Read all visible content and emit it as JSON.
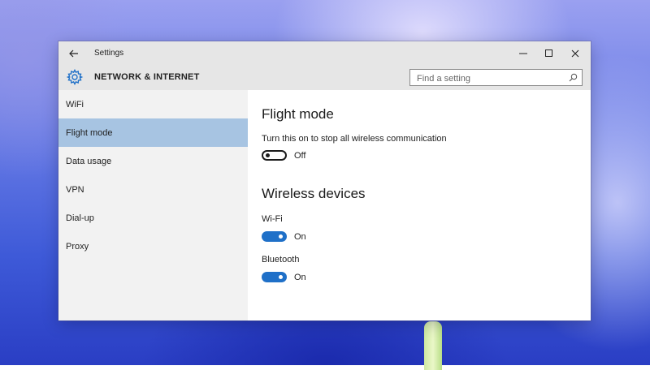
{
  "window": {
    "title": "Settings",
    "controls": [
      "minimize",
      "maximize",
      "close"
    ]
  },
  "header": {
    "section_title": "NETWORK & INTERNET",
    "search_placeholder": "Find a setting",
    "search_value": ""
  },
  "sidebar": {
    "items": [
      {
        "label": "WiFi",
        "selected": false
      },
      {
        "label": "Flight mode",
        "selected": true
      },
      {
        "label": "Data usage",
        "selected": false
      },
      {
        "label": "VPN",
        "selected": false
      },
      {
        "label": "Dial-up",
        "selected": false
      },
      {
        "label": "Proxy",
        "selected": false
      }
    ]
  },
  "flight_mode": {
    "heading": "Flight mode",
    "description": "Turn this on to stop all wireless communication",
    "state_label": "Off",
    "enabled": false
  },
  "wireless_devices": {
    "heading": "Wireless devices",
    "devices": [
      {
        "name": "Wi-Fi",
        "state_label": "On",
        "enabled": true
      },
      {
        "name": "Bluetooth",
        "state_label": "On",
        "enabled": true
      }
    ]
  },
  "colors": {
    "accent": "#1f70c8",
    "selected_nav": "#a7c4e2",
    "chrome": "#e6e6e6",
    "sidebar": "#f2f2f2"
  },
  "icons": {
    "back": "back-arrow-icon",
    "settings": "gear-icon",
    "search": "search-icon",
    "minimize": "minimize-icon",
    "maximize": "maximize-icon",
    "close": "close-icon"
  }
}
